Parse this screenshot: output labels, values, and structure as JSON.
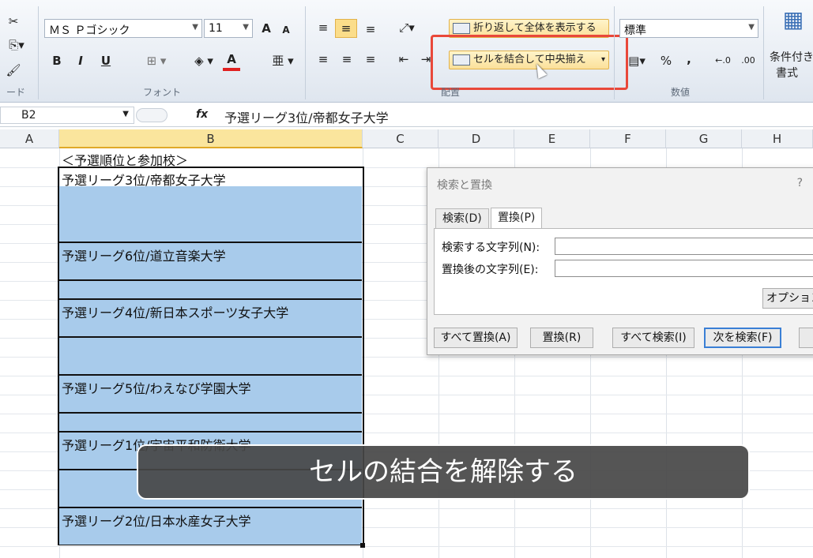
{
  "ribbon": {
    "clipboard": {
      "label": "ード"
    },
    "font": {
      "name": "ＭＳ Ｐゴシック",
      "size": "11",
      "group_label": "フォント",
      "bold": "B",
      "italic": "I",
      "underline": "U",
      "font_color_letter": "A",
      "grow": "A",
      "shrink": "A"
    },
    "alignment": {
      "wrap_label": "折り返して全体を表示する",
      "merge_label": "セルを結合して中央揃え",
      "group_label": "配置"
    },
    "number": {
      "format": "標準",
      "percent": "%",
      "comma": ",",
      "group_label": "数値"
    },
    "styles": {
      "conditional_label": "条件付き",
      "conditional_label2": "書式"
    }
  },
  "formula_bar": {
    "name_box": "B2",
    "fx": "fx",
    "content": "予選リーグ3位/帝都女子大学"
  },
  "columns": [
    "A",
    "B",
    "C",
    "D",
    "E",
    "F",
    "G",
    "H"
  ],
  "cells": {
    "b1": "＜予選順位と参加校＞",
    "rows": [
      "予選リーグ3位/帝都女子大学",
      "予選リーグ6位/道立音楽大学",
      "予選リーグ4位/新日本スポーツ女子大学",
      "予選リーグ5位/わえなび学園大学",
      "予選リーグ1位/宇宙平和防衛大学",
      "予選リーグ2位/日本水産女子大学"
    ]
  },
  "dialog": {
    "title": "検索と置換",
    "help": "?",
    "tabs": [
      "検索(D)",
      "置換(P)"
    ],
    "find_label": "検索する文字列(N):",
    "replace_label": "置換後の文字列(E):",
    "options_button": "オプション",
    "buttons": [
      "すべて置換(A)",
      "置換(R)",
      "すべて検索(I)",
      "次を検索(F)"
    ]
  },
  "caption": "セルの結合を解除する"
}
